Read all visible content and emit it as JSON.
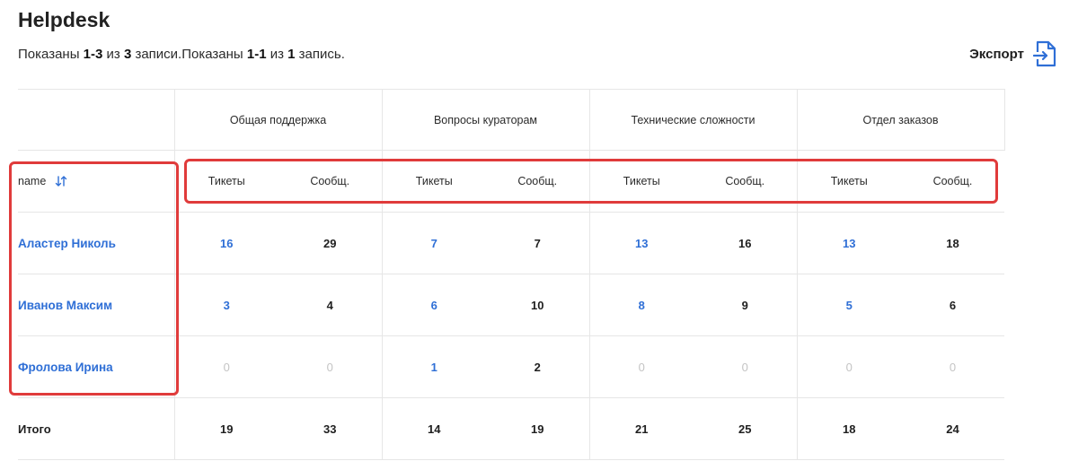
{
  "page": {
    "title": "Helpdesk",
    "summary": [
      {
        "text": "Показаны ",
        "bold": false
      },
      {
        "text": "1-3",
        "bold": true
      },
      {
        "text": " из ",
        "bold": false
      },
      {
        "text": "3",
        "bold": true
      },
      {
        "text": " записи.Показаны ",
        "bold": false
      },
      {
        "text": "1-1",
        "bold": true
      },
      {
        "text": " из ",
        "bold": false
      },
      {
        "text": "1",
        "bold": true
      },
      {
        "text": " запись.",
        "bold": false
      }
    ],
    "export_label": "Экспорт"
  },
  "colors": {
    "link": "#2f6fd6",
    "highlight": "#e03b3b",
    "zero": "#c4c4c4"
  },
  "table": {
    "name_header": "name",
    "groups": [
      "Общая поддержка",
      "Вопросы кураторам",
      "Технические сложности",
      "Отдел заказов"
    ],
    "subheaders": [
      "Тикеты",
      "Сообщ."
    ],
    "rows": [
      {
        "name": "Аластер Николь",
        "values": [
          16,
          29,
          7,
          7,
          13,
          16,
          13,
          18
        ]
      },
      {
        "name": "Иванов Максим",
        "values": [
          3,
          4,
          6,
          10,
          8,
          9,
          5,
          6
        ]
      },
      {
        "name": "Фролова Ирина",
        "values": [
          0,
          0,
          1,
          2,
          0,
          0,
          0,
          0
        ]
      }
    ],
    "total": {
      "label": "Итого",
      "values": [
        19,
        33,
        14,
        19,
        21,
        25,
        18,
        24
      ]
    }
  }
}
